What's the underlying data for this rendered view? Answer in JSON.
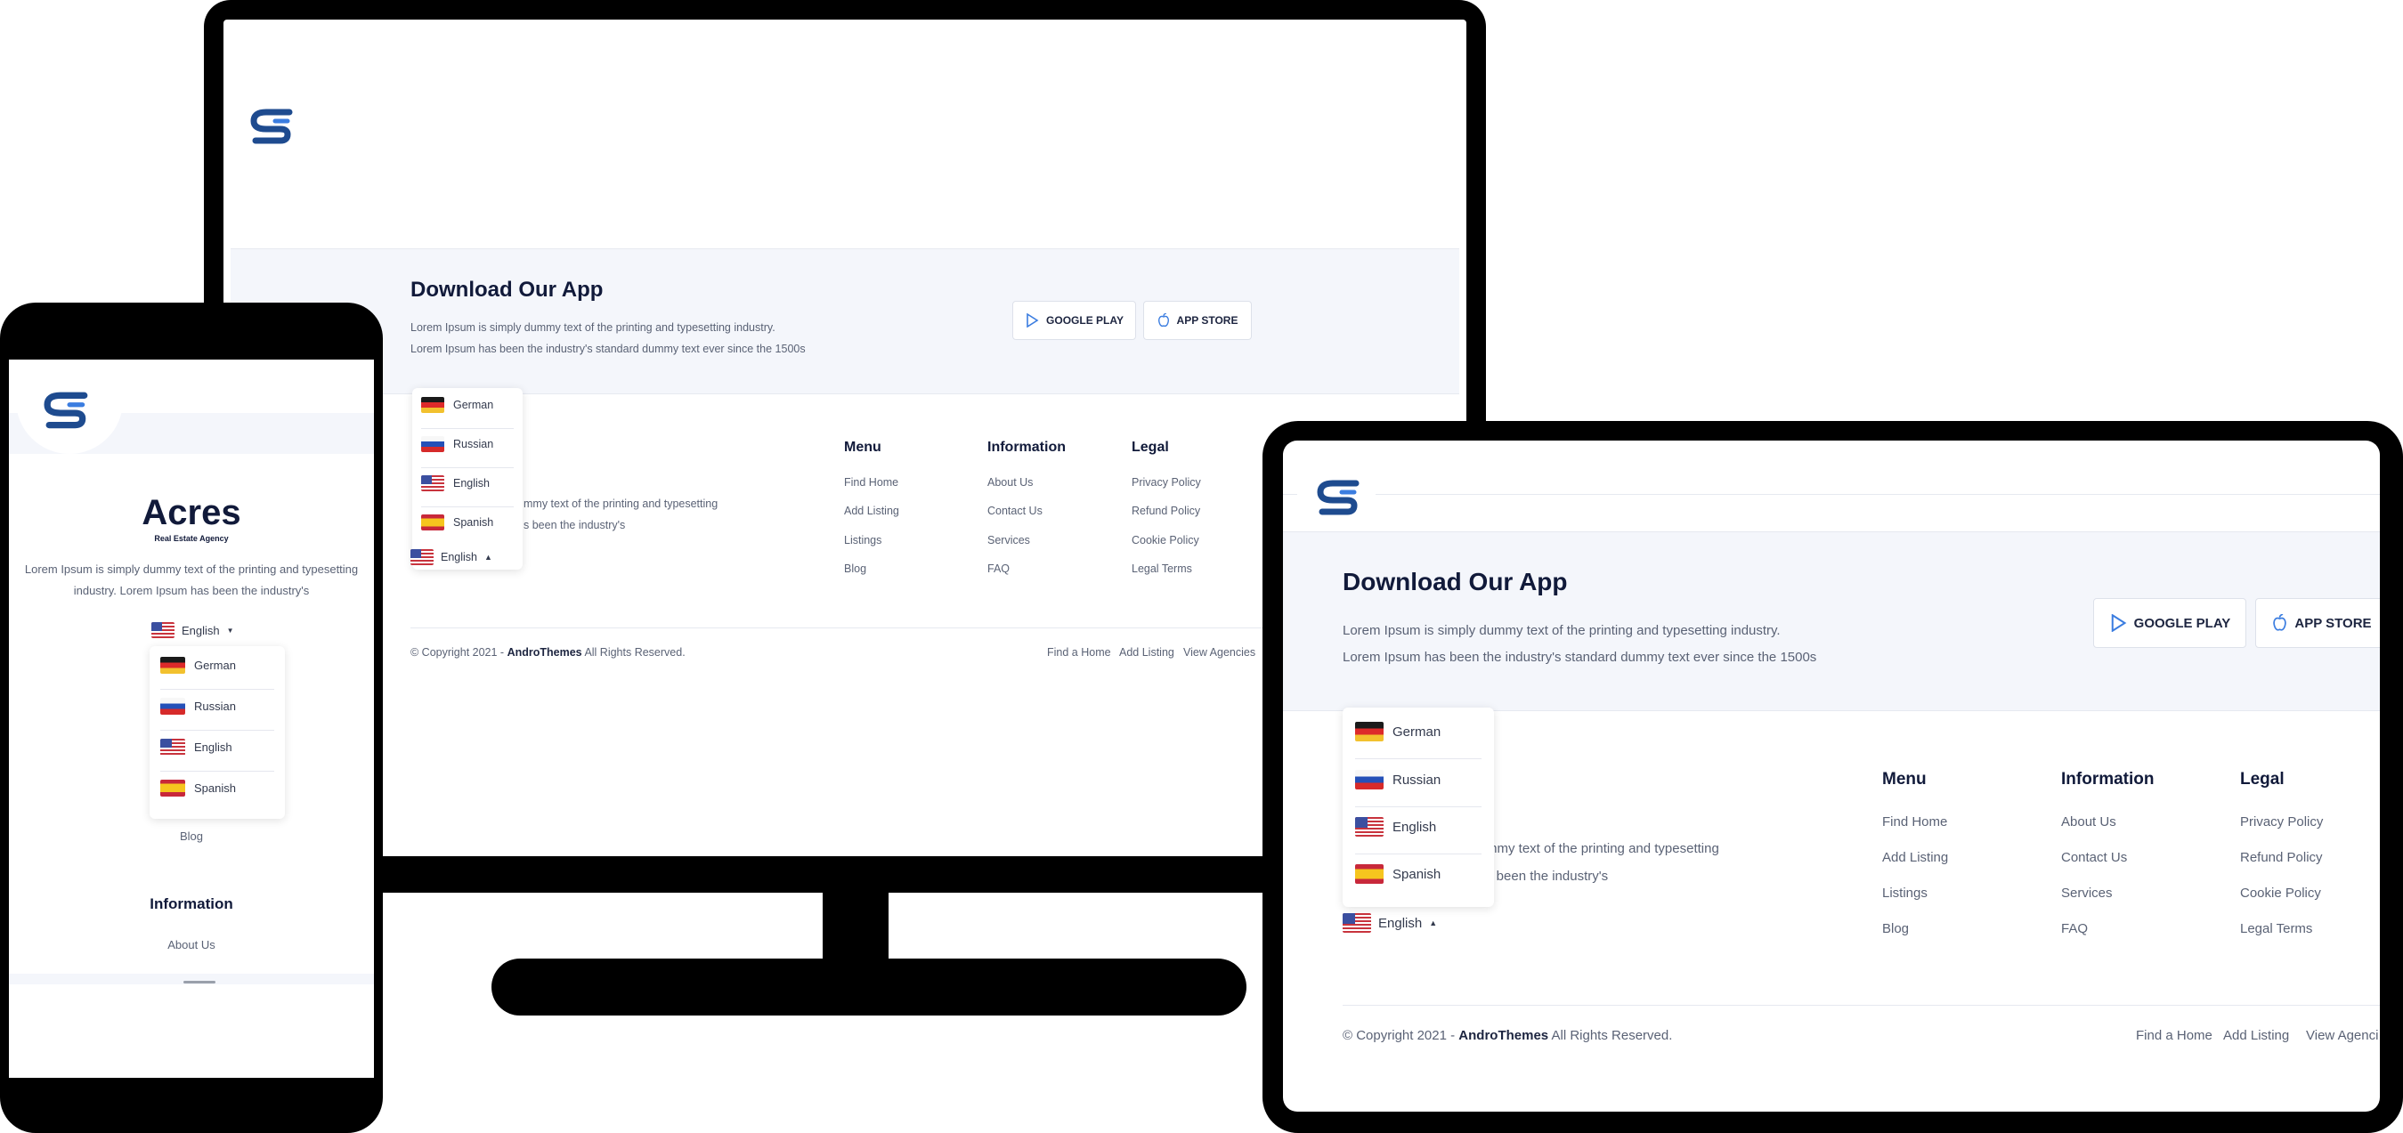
{
  "brand": {
    "logo_icon": "sp-logo-icon",
    "logo_color": "#1e4b8f",
    "name": "Acres",
    "tagline": "Real Estate Agency"
  },
  "app": {
    "title": "Download Our App",
    "line1": "Lorem Ipsum is simply dummy text of the printing and typesetting industry.",
    "line2": "Lorem Ipsum has been the industry's standard dummy text ever since the 1500s",
    "google_play": "GOOGLE PLAY",
    "app_store": "APP STORE",
    "google_play_icon": "google-play-icon",
    "app_store_icon": "apple-icon",
    "accent": "#3b7de0"
  },
  "about": {
    "partial1": "mmy text of the printing and typesetting",
    "partial2": "s been the industry's",
    "phone_line1": "Lorem Ipsum is simply dummy text of the printing and typesetting",
    "phone_line2": "industry. Lorem Ipsum has been the industry's"
  },
  "languages": {
    "selected": "English",
    "options": [
      "German",
      "Russian",
      "English",
      "Spanish"
    ]
  },
  "columns": {
    "menu": {
      "title": "Menu",
      "links": [
        "Find Home",
        "Add Listing",
        "Listings",
        "Blog"
      ]
    },
    "information": {
      "title": "Information",
      "links": [
        "About Us",
        "Contact Us",
        "Services",
        "FAQ"
      ]
    },
    "legal": {
      "title": "Legal",
      "links": [
        "Privacy Policy",
        "Refund Policy",
        "Cookie Policy",
        "Legal Terms"
      ]
    }
  },
  "footer": {
    "copyright_prefix": "© Copyright 2021 -",
    "copyright_brand": "AndroThemes",
    "copyright_suffix": "All Rights Reserved.",
    "links": [
      "Find a Home",
      "Add Listing",
      "View Agencies"
    ],
    "tablet_last_link": "View Agenci"
  },
  "phone": {
    "blog": "Blog",
    "info_title": "Information",
    "about_us": "About Us"
  }
}
